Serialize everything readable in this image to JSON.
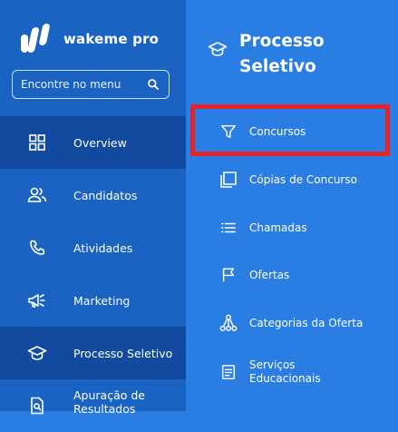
{
  "brand": {
    "name": "wakeme pro",
    "logo_icon": "wakeme-logo-icon"
  },
  "search": {
    "placeholder": "Encontre no menu",
    "icon": "search-icon"
  },
  "sidebar": {
    "items": [
      {
        "label": "Overview",
        "icon": "grid-icon",
        "active": false
      },
      {
        "label": "Candidatos",
        "icon": "users-icon",
        "active": false
      },
      {
        "label": "Atividades",
        "icon": "phone-icon",
        "active": false
      },
      {
        "label": "Marketing",
        "icon": "megaphone-icon",
        "active": false
      },
      {
        "label": "Processo Seletivo",
        "icon": "graduation-cap-icon",
        "active": true
      },
      {
        "label": "Apuração de Resultados",
        "icon": "document-search-icon",
        "active": false
      }
    ]
  },
  "panel": {
    "title": "Processo Seletivo",
    "icon": "graduation-cap-icon",
    "items": [
      {
        "label": "Concursos",
        "icon": "filter-icon",
        "highlighted": true
      },
      {
        "label": "Cópias de Concurso",
        "icon": "copy-icon"
      },
      {
        "label": "Chamadas",
        "icon": "list-icon"
      },
      {
        "label": "Ofertas",
        "icon": "flag-icon"
      },
      {
        "label": "Categorias da Oferta",
        "icon": "hierarchy-icon"
      },
      {
        "label": "Serviços Educacionais",
        "icon": "document-icon"
      }
    ]
  },
  "colors": {
    "sidebar_bg": "#1a63c3",
    "sidebar_active_bg": "#114a9f",
    "panel_bg": "#2a7de3",
    "highlight_border": "#e5232a"
  }
}
